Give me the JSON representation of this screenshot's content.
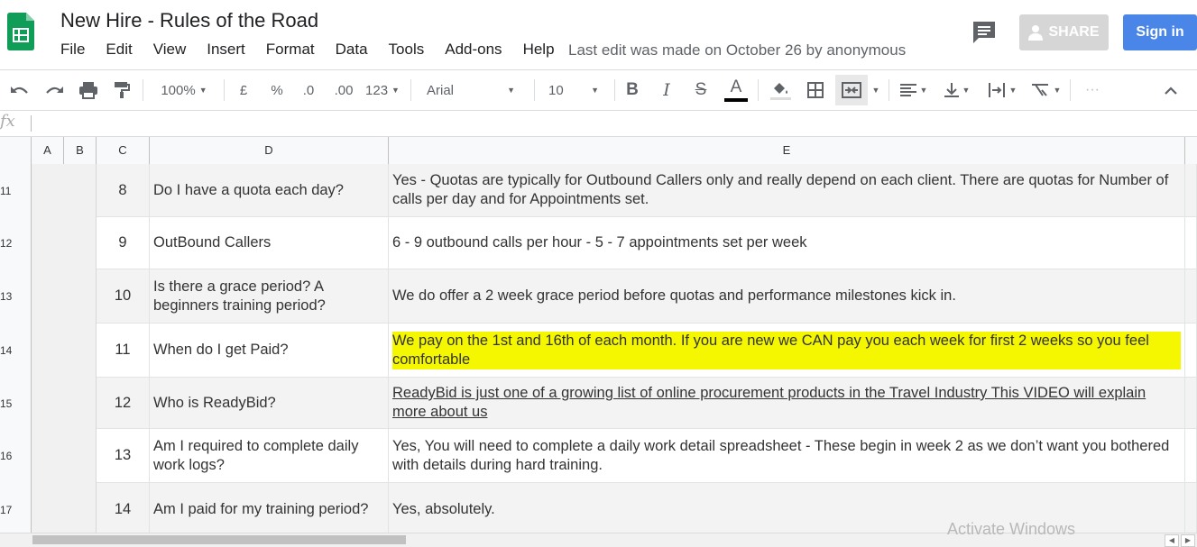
{
  "doc": {
    "title": "New Hire - Rules of the Road",
    "last_edit": "Last edit was made on October 26 by anonymous"
  },
  "menu": [
    "File",
    "Edit",
    "View",
    "Insert",
    "Format",
    "Data",
    "Tools",
    "Add-ons",
    "Help"
  ],
  "header": {
    "share_label": "SHARE",
    "signin_label": "Sign in"
  },
  "toolbar": {
    "zoom": "100%",
    "currency": "£",
    "percent": "%",
    "dec_decrease": ".0",
    "dec_increase": ".00",
    "more_formats": "123",
    "font": "Arial",
    "font_size": "10",
    "more": "···"
  },
  "formula_bar": {
    "fx_label": "fx",
    "value": ""
  },
  "columns": [
    "A",
    "B",
    "C",
    "D",
    "E"
  ],
  "rows": [
    {
      "num": "11",
      "c": "8",
      "d": "Do I have a quota each day?",
      "e": "Yes - Quotas are typically for Outbound Callers only and really depend on each client. There are quotas for Number of calls per day and for Appointments set."
    },
    {
      "num": "12",
      "c": "9",
      "d": "OutBound Callers",
      "e": "6 - 9 outbound calls per hour - 5 - 7 appointments set per week"
    },
    {
      "num": "13",
      "c": "10",
      "d": "Is there a grace period? A beginners training period?",
      "e": "We do offer a 2 week grace period before quotas and performance milestones kick in."
    },
    {
      "num": "14",
      "c": "11",
      "d": "When do I get Paid?",
      "e": "We pay on the 1st and 16th of each month. If you are new we CAN pay you each week for first 2 weeks so you feel comfortable"
    },
    {
      "num": "15",
      "c": "12",
      "d": "Who is ReadyBid?",
      "e": "ReadyBid is just one of a growing list of online procurement products in the Travel Industry   This VIDEO will explain more about us"
    },
    {
      "num": "16",
      "c": "13",
      "d": "Am I required to complete daily work logs?",
      "e": "Yes, You will need to complete a daily work detail spreadsheet - These begin in week 2 as we don’t want you bothered with details during hard training."
    },
    {
      "num": "17",
      "c": "14",
      "d": "Am I paid for my training period?",
      "e": "Yes, absolutely."
    }
  ],
  "watermark": "Activate Windows",
  "colors": {
    "highlight": "#f5f700",
    "signin": "#4a86e8",
    "sheets_green": "#0f9d58"
  }
}
